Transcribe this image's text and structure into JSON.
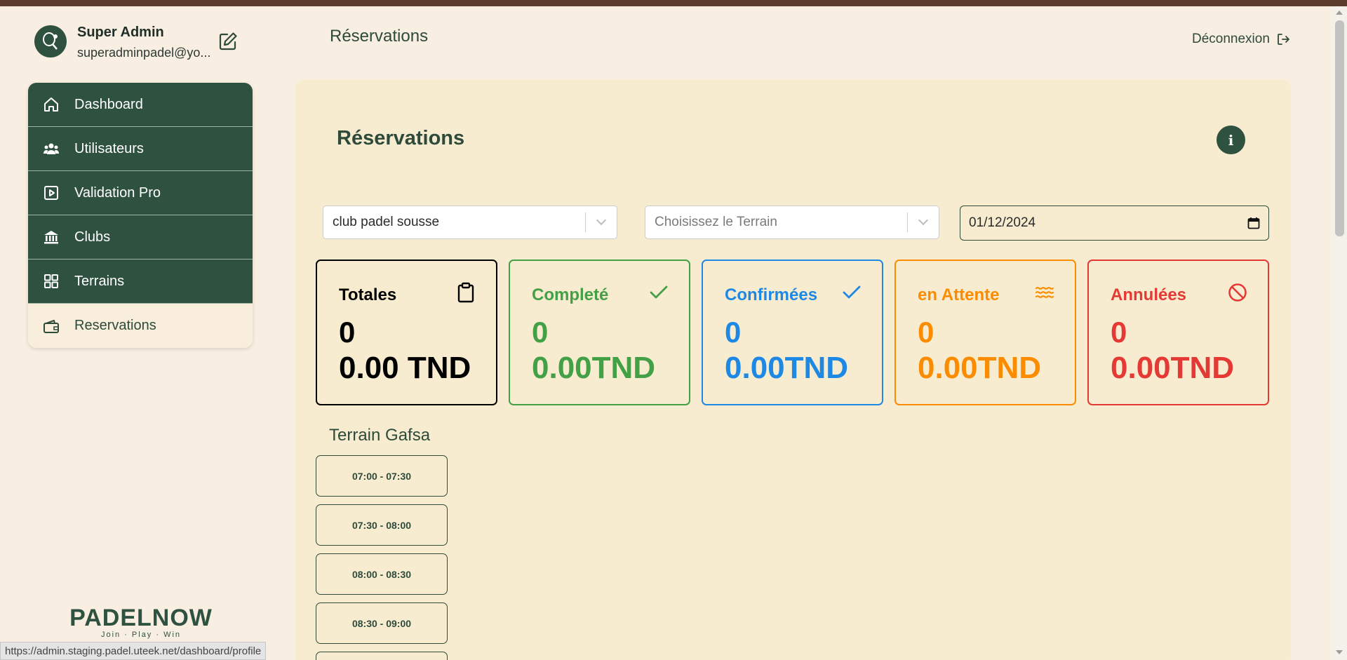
{
  "profile": {
    "name": "Super Admin",
    "email": "superadminpadel@yo..."
  },
  "nav": {
    "items": [
      {
        "label": "Dashboard",
        "icon": "home-icon"
      },
      {
        "label": "Utilisateurs",
        "icon": "users-icon"
      },
      {
        "label": "Validation Pro",
        "icon": "play-square-icon"
      },
      {
        "label": "Clubs",
        "icon": "bank-icon"
      },
      {
        "label": "Terrains",
        "icon": "grid-icon"
      },
      {
        "label": "Reservations",
        "icon": "wallet-icon",
        "active": true
      }
    ]
  },
  "logo": {
    "text": "PADELNOW",
    "tagline": "Join · Play · Win"
  },
  "header": {
    "title": "Réservations",
    "logout_label": "Déconnexion"
  },
  "main": {
    "title": "Réservations",
    "filters": {
      "club_value": "club padel sousse",
      "terrain_placeholder": "Choisissez le Terrain",
      "date_value": "01/12/2024"
    },
    "cards": [
      {
        "title": "Totales",
        "count": "0",
        "amount": "0.00 TND",
        "color": "#000000",
        "icon": "clipboard-icon"
      },
      {
        "title": "Completé",
        "count": "0",
        "amount": "0.00TND",
        "color": "#43a047",
        "icon": "check-icon"
      },
      {
        "title": "Confirmées",
        "count": "0",
        "amount": "0.00TND",
        "color": "#1e88e5",
        "icon": "check-icon"
      },
      {
        "title": "en Attente",
        "count": "0",
        "amount": "0.00TND",
        "color": "#fb8c00",
        "icon": "waves-icon"
      },
      {
        "title": "Annulées",
        "count": "0",
        "amount": "0.00TND",
        "color": "#e53935",
        "icon": "ban-icon"
      }
    ],
    "terrain": {
      "name": "Terrain Gafsa",
      "slots": [
        "07:00 - 07:30",
        "07:30 - 08:00",
        "08:00 - 08:30",
        "08:30 - 09:00"
      ]
    }
  },
  "status_url": "https://admin.staging.padel.uteek.net/dashboard/profile",
  "colors": {
    "primary": "#2f5240",
    "page_bg": "#f8eee1",
    "panel_bg": "#f7eccf"
  }
}
